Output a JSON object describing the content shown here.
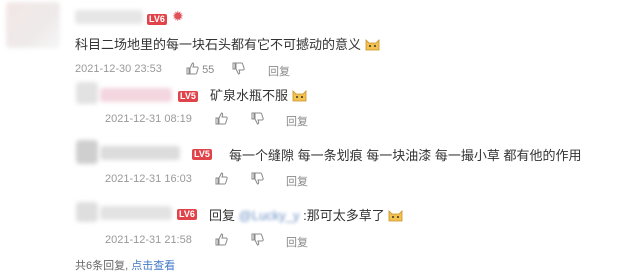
{
  "comment": {
    "level": "LV6",
    "text": "科目二场地里的每一块石头都有它不可撼动的意义",
    "time": "2021-12-30 23:53",
    "likes": "55",
    "reply_label": "回复"
  },
  "replies": [
    {
      "level": "LV5",
      "text": "矿泉水瓶不服",
      "time": "2021-12-31 08:19",
      "reply_label": "回复"
    },
    {
      "level": "LV5",
      "text": "每一个缝隙 每一条划痕 每一块油漆 每一撮小草 都有他的作用",
      "time": "2021-12-31 16:03",
      "reply_label": "回复"
    },
    {
      "level": "LV6",
      "prefix": "回复",
      "mention": "@Lucky_y",
      "text": ":那可太多草了",
      "time": "2021-12-31 21:58",
      "reply_label": "回复"
    }
  ],
  "footer": {
    "count_text": "共6条回复,",
    "expand_link": "点击查看"
  },
  "colors": {
    "level_badge": "#e0444a",
    "link": "#4479c7",
    "meta": "#999999"
  },
  "icons": [
    "thumbs-up-icon",
    "thumbs-down-icon",
    "cat-emoji-icon",
    "crown-icon"
  ]
}
